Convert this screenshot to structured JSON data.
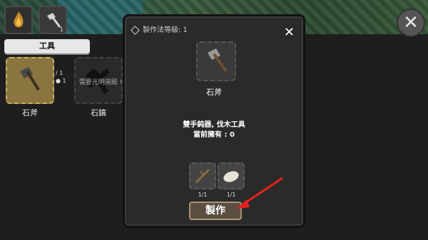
{
  "hud": {
    "axe_count": "1"
  },
  "category_tab": {
    "label": "工具"
  },
  "recipes": [
    {
      "name": "石斧",
      "req_counts": [
        "1",
        "1"
      ]
    },
    {
      "name": "石鎬",
      "lock_note": "需要光明道殿 !"
    }
  ],
  "modal": {
    "header": "製作法等級: 1",
    "item_name": "石斧",
    "desc_line1": "雙手鈍器, 伐木工具",
    "desc_line2": "當前擁有 : 0",
    "ingredient_counts": [
      "1/1",
      "1/1"
    ],
    "craft_label": "製作"
  },
  "colors": {
    "craft_button": "#5b4f41",
    "arrow": "#e8201c",
    "selected_recipe_bg": "#8a7440"
  }
}
